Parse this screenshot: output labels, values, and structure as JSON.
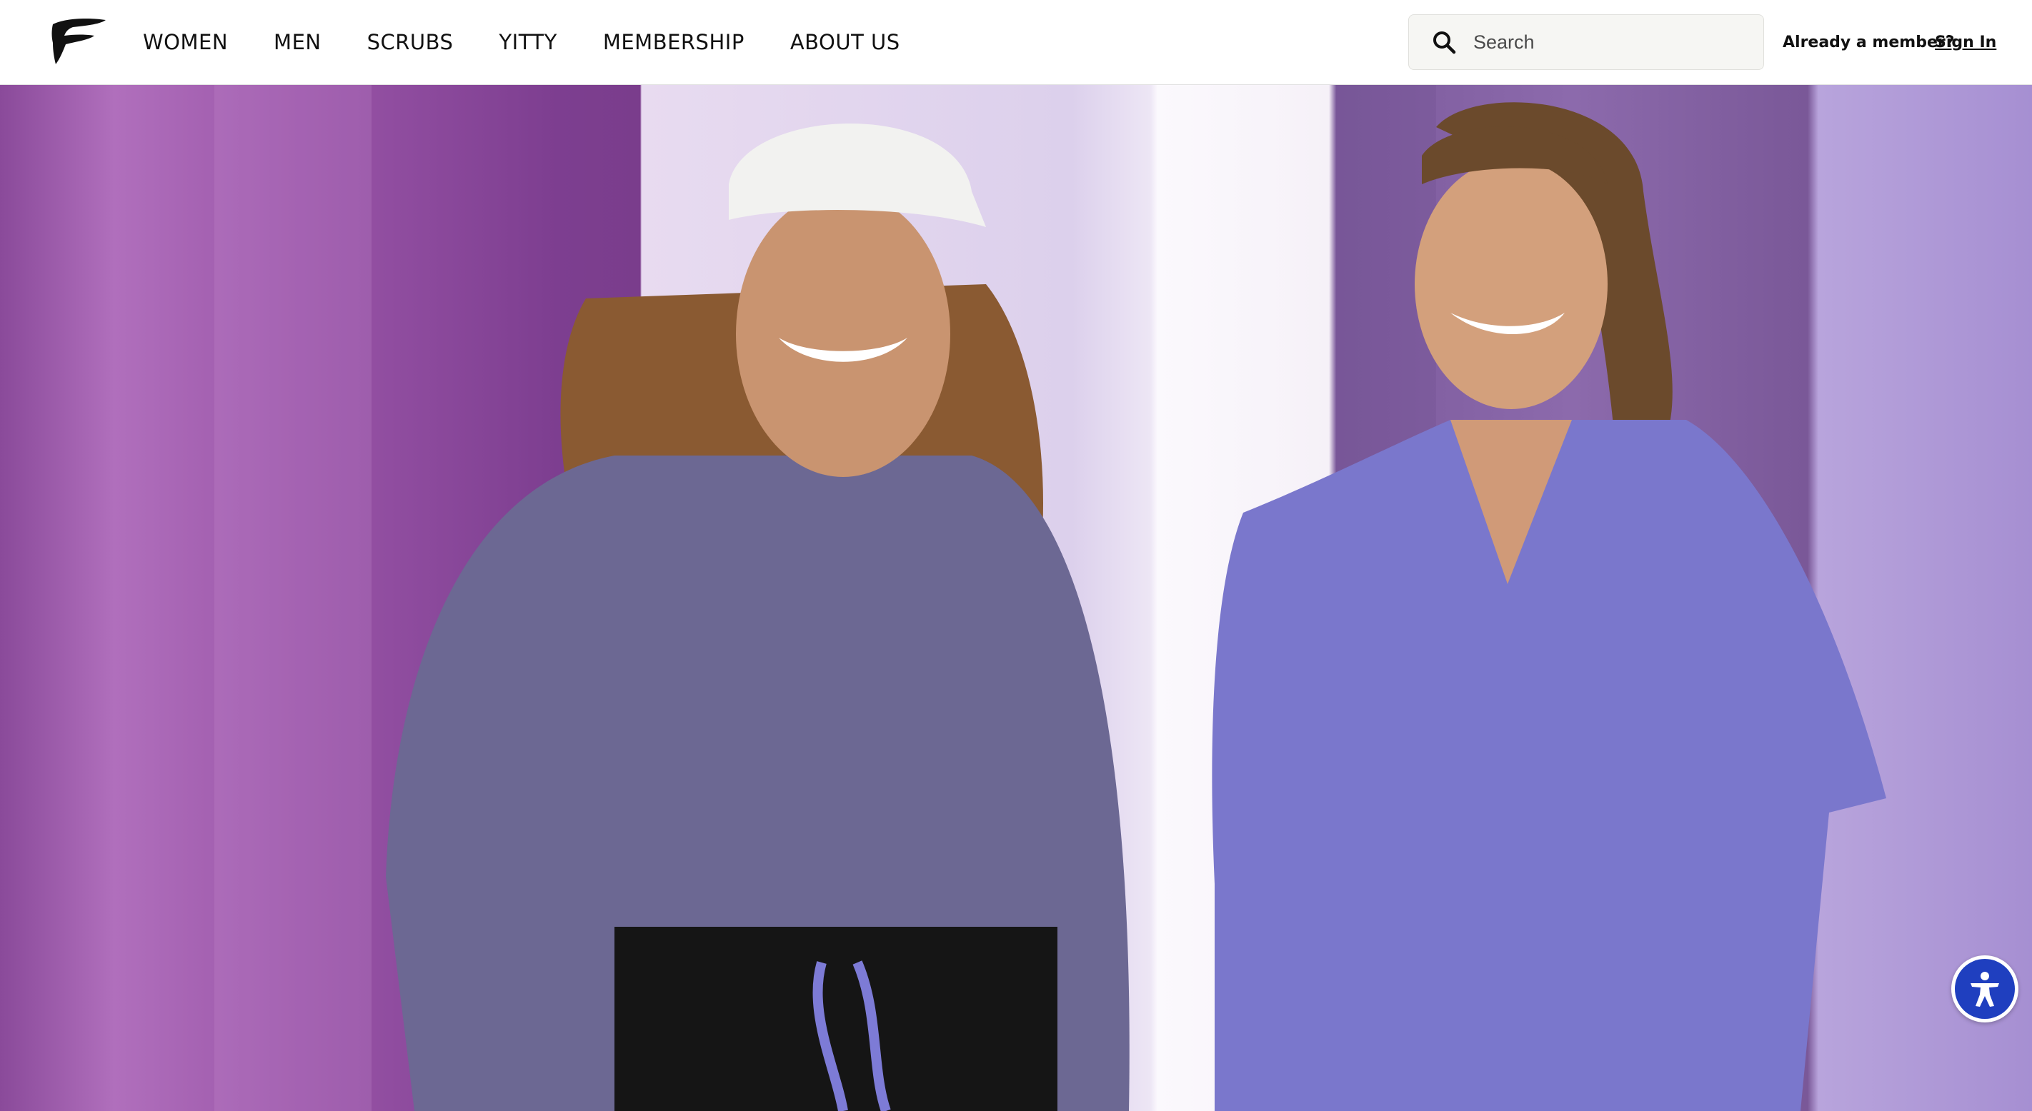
{
  "nav": {
    "items": [
      {
        "label": "WOMEN"
      },
      {
        "label": "MEN"
      },
      {
        "label": "SCRUBS"
      },
      {
        "label": "YITTY"
      },
      {
        "label": "MEMBERSHIP"
      },
      {
        "label": "ABOUT US"
      }
    ]
  },
  "search": {
    "placeholder": "Search"
  },
  "account": {
    "member_prompt": "Already a member?",
    "sign_in_label": "Sign In"
  },
  "icons": {
    "logo": "brand-logo-icon",
    "search": "search-icon",
    "accessibility": "accessibility-icon"
  },
  "colors": {
    "header_bg": "#ffffff",
    "accessibility_button": "#1f3fbf",
    "scrub_top": "#7a77cc",
    "heather_tee": "#6c6893"
  }
}
